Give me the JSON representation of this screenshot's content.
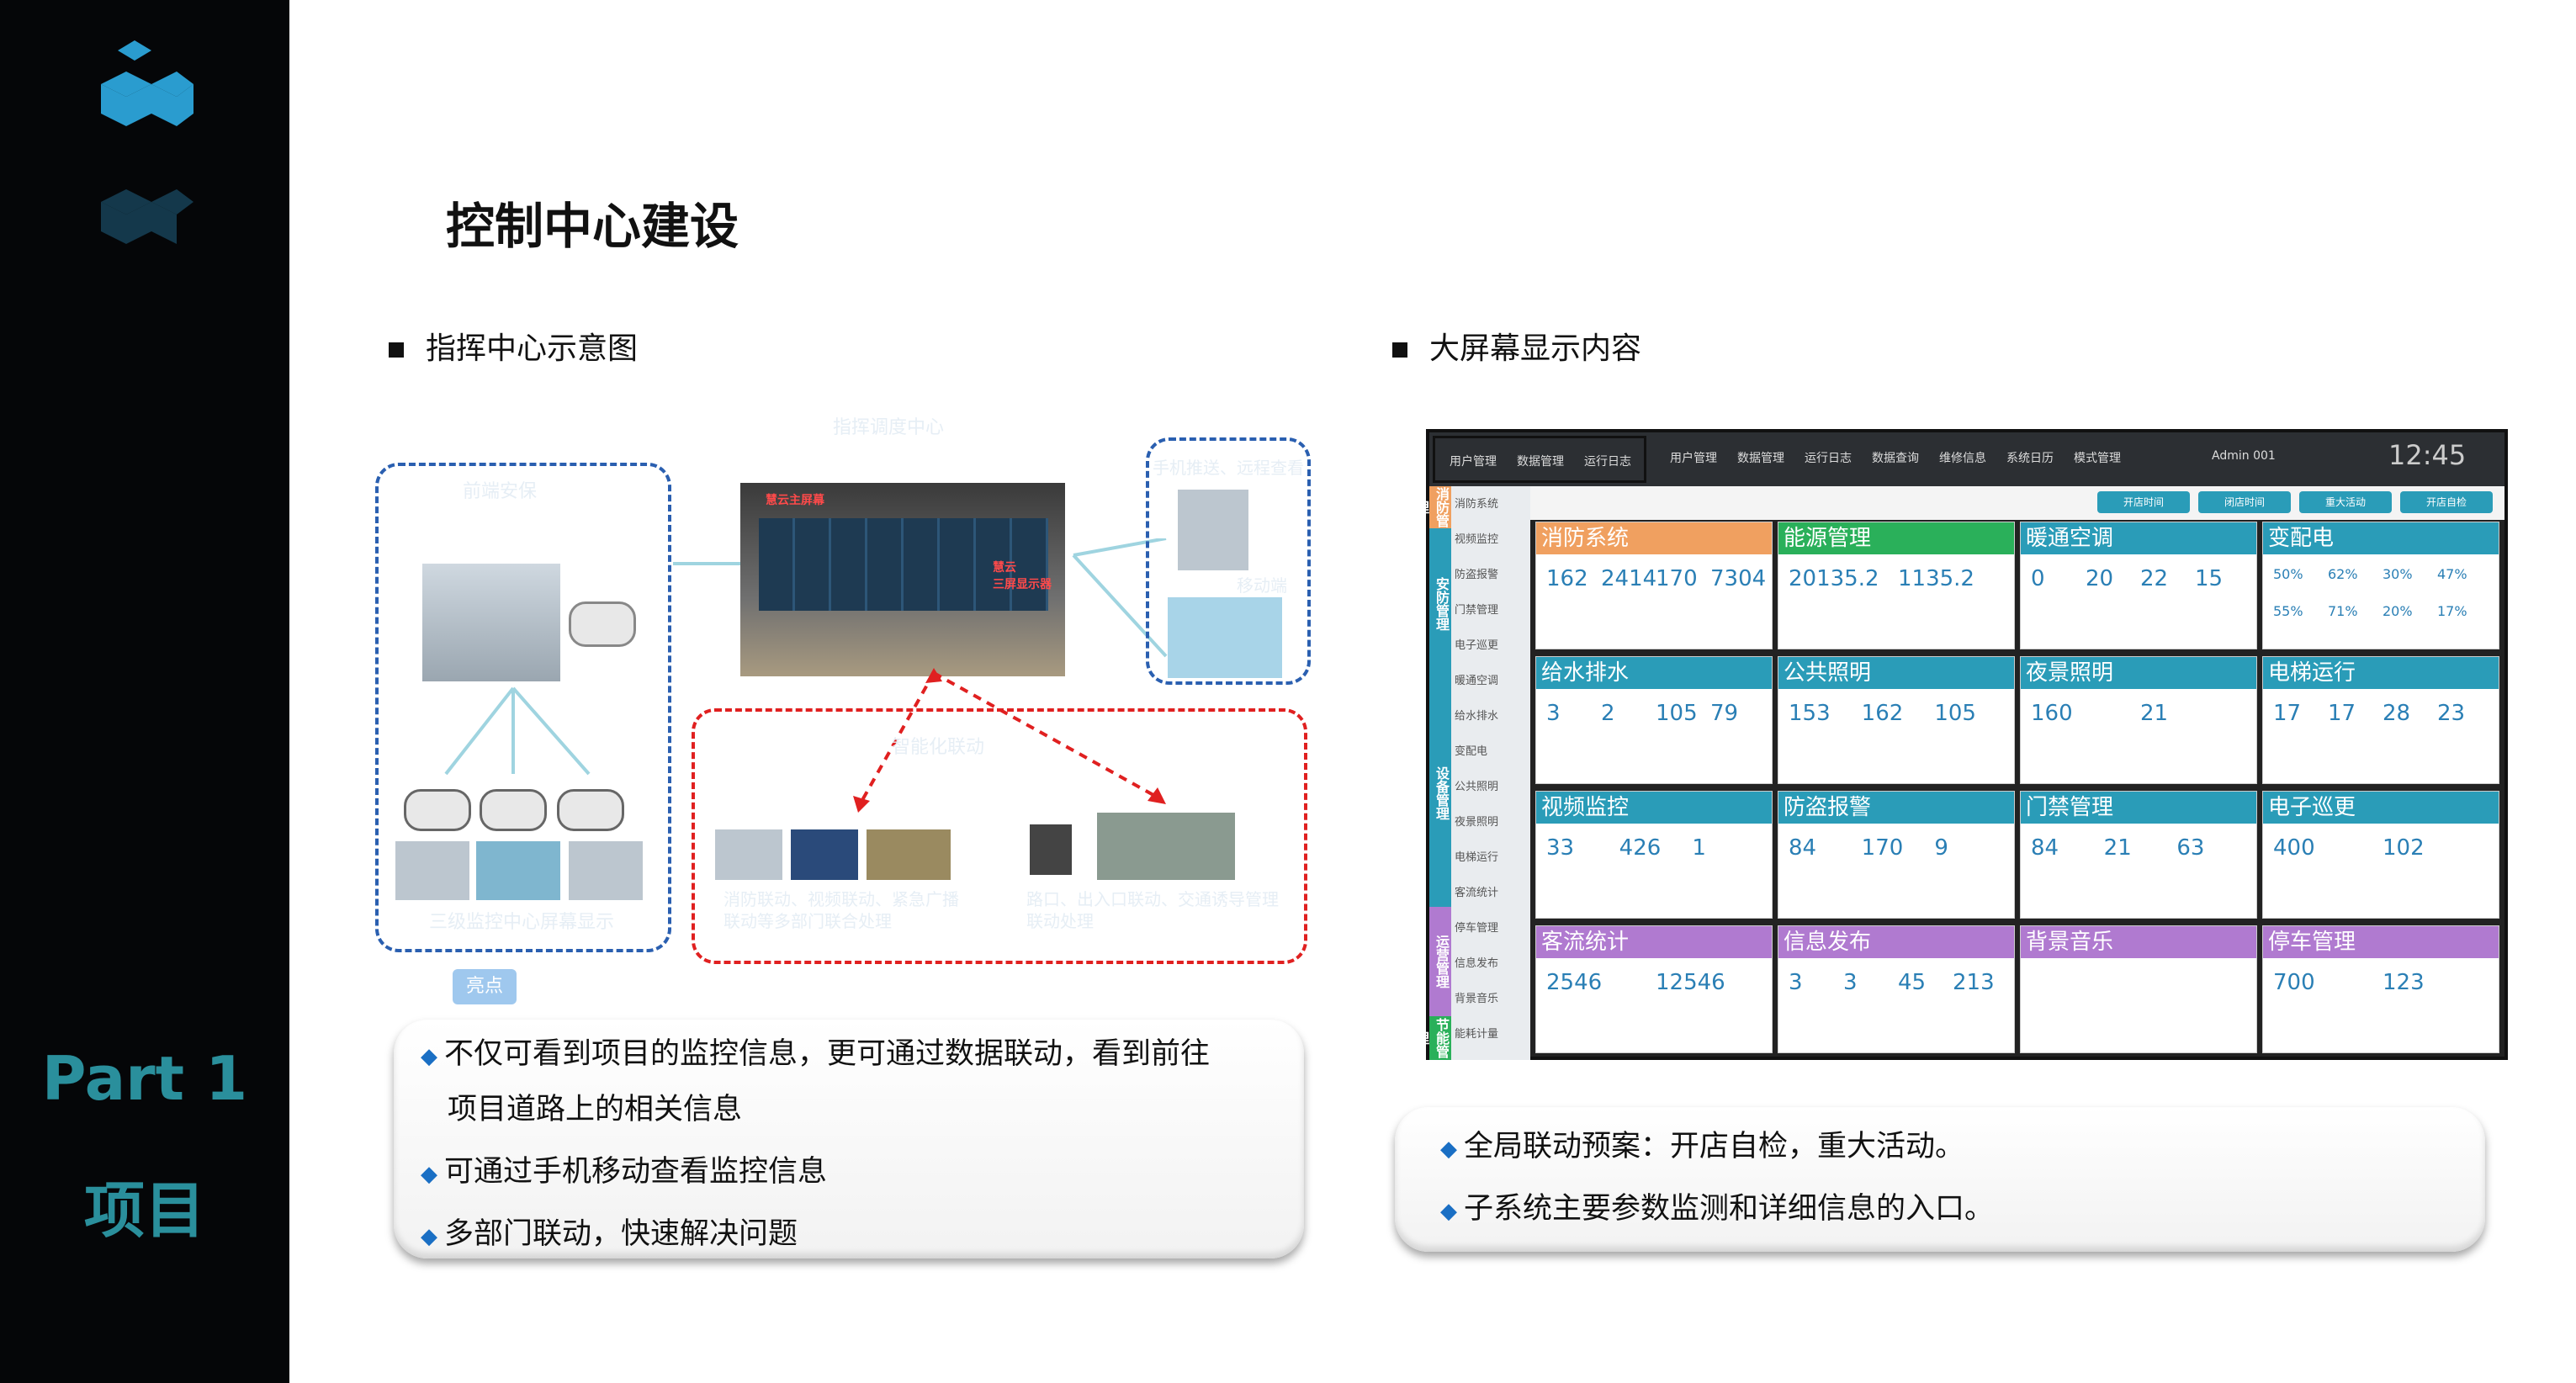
{
  "sidebar": {
    "part": "Part 1",
    "section": "项目"
  },
  "title": "控制中心建设",
  "left": {
    "heading": "指挥中心示意图",
    "diagram": {
      "top_center": "指挥调度中心",
      "left_box": "前端安保",
      "screen_label1": "慧云主屏幕",
      "screen_label2": "慧云\n三屏显示器",
      "right_box": "手机推送、远程查看",
      "right_mid": "移动端",
      "bottom_left": "三级监控中心屏幕显示",
      "red_label": "智能化联动",
      "red_cap1": "消防联动、视频联动、紧急广播联动等多部门联合处理",
      "red_cap2": "路口、出入口联动、交通诱导管理联动处理",
      "badge": "亮点"
    },
    "bullets": [
      "不仅可看到项目的监控信息，更可通过数据联动，看到前往",
      "项目道路上的相关信息",
      "可通过手机移动查看监控信息",
      "多部门联动，快速解决问题"
    ]
  },
  "right": {
    "heading": "大屏幕显示内容",
    "bullets": [
      "全局联动预案：开店自检，重大活动。",
      "子系统主要参数监测和详细信息的入口。"
    ],
    "dash": {
      "nav": [
        "用户管理",
        "数据管理",
        "运行日志",
        "用户管理",
        "数据管理",
        "运行日志",
        "数据查询",
        "维修信息",
        "系统日历",
        "模式管理"
      ],
      "admin": "Admin 001",
      "time": "12:45",
      "buttons": [
        "开店时间",
        "闭店时间",
        "重大活动",
        "开店自检"
      ],
      "categories": [
        "消防管理",
        "安防管理",
        "设备管理",
        "运营管理",
        "节能管理"
      ],
      "side_items": [
        "消防系统",
        "视频监控",
        "防盗报警",
        "门禁管理",
        "电子巡更",
        "暖通空调",
        "给水排水",
        "变配电",
        "公共照明",
        "夜景照明",
        "电梯运行",
        "客流统计",
        "停车管理",
        "信息发布",
        "背景音乐",
        "能耗计量"
      ],
      "panels": [
        {
          "title": "消防系统",
          "color": "#f0a060",
          "values": [
            "162",
            "2414",
            "170",
            "7304"
          ]
        },
        {
          "title": "能源管理",
          "color": "#2ab05a",
          "values": [
            "20135.2",
            "1135.2"
          ]
        },
        {
          "title": "暖通空调",
          "color": "#2a9cb8",
          "values": [
            "0",
            "20",
            "22",
            "15"
          ]
        },
        {
          "title": "变配电",
          "color": "#2a9cb8",
          "values": [
            "50%",
            "62%",
            "30%",
            "47%",
            "55%",
            "71%",
            "20%",
            "17%"
          ]
        },
        {
          "title": "给水排水",
          "color": "#2a9cb8",
          "values": [
            "3",
            "2",
            "105",
            "79"
          ]
        },
        {
          "title": "公共照明",
          "color": "#2a9cb8",
          "values": [
            "153",
            "162",
            "105"
          ]
        },
        {
          "title": "夜景照明",
          "color": "#2a9cb8",
          "values": [
            "160",
            "21"
          ]
        },
        {
          "title": "电梯运行",
          "color": "#2a9cb8",
          "values": [
            "17",
            "17",
            "28",
            "23"
          ]
        },
        {
          "title": "视频监控",
          "color": "#2a9cb8",
          "values": [
            "33",
            "426",
            "1"
          ]
        },
        {
          "title": "防盗报警",
          "color": "#2a9cb8",
          "values": [
            "84",
            "170",
            "9"
          ]
        },
        {
          "title": "门禁管理",
          "color": "#2a9cb8",
          "values": [
            "84",
            "21",
            "63"
          ]
        },
        {
          "title": "电子巡更",
          "color": "#2a9cb8",
          "values": [
            "400",
            "102"
          ]
        },
        {
          "title": "客流统计",
          "color": "#b07ad0",
          "values": [
            "2546",
            "12546"
          ]
        },
        {
          "title": "信息发布",
          "color": "#b07ad0",
          "values": [
            "3",
            "3",
            "45",
            "213"
          ]
        },
        {
          "title": "背景音乐",
          "color": "#b07ad0",
          "values": []
        },
        {
          "title": "停车管理",
          "color": "#b07ad0",
          "values": [
            "700",
            "123"
          ]
        }
      ]
    }
  }
}
